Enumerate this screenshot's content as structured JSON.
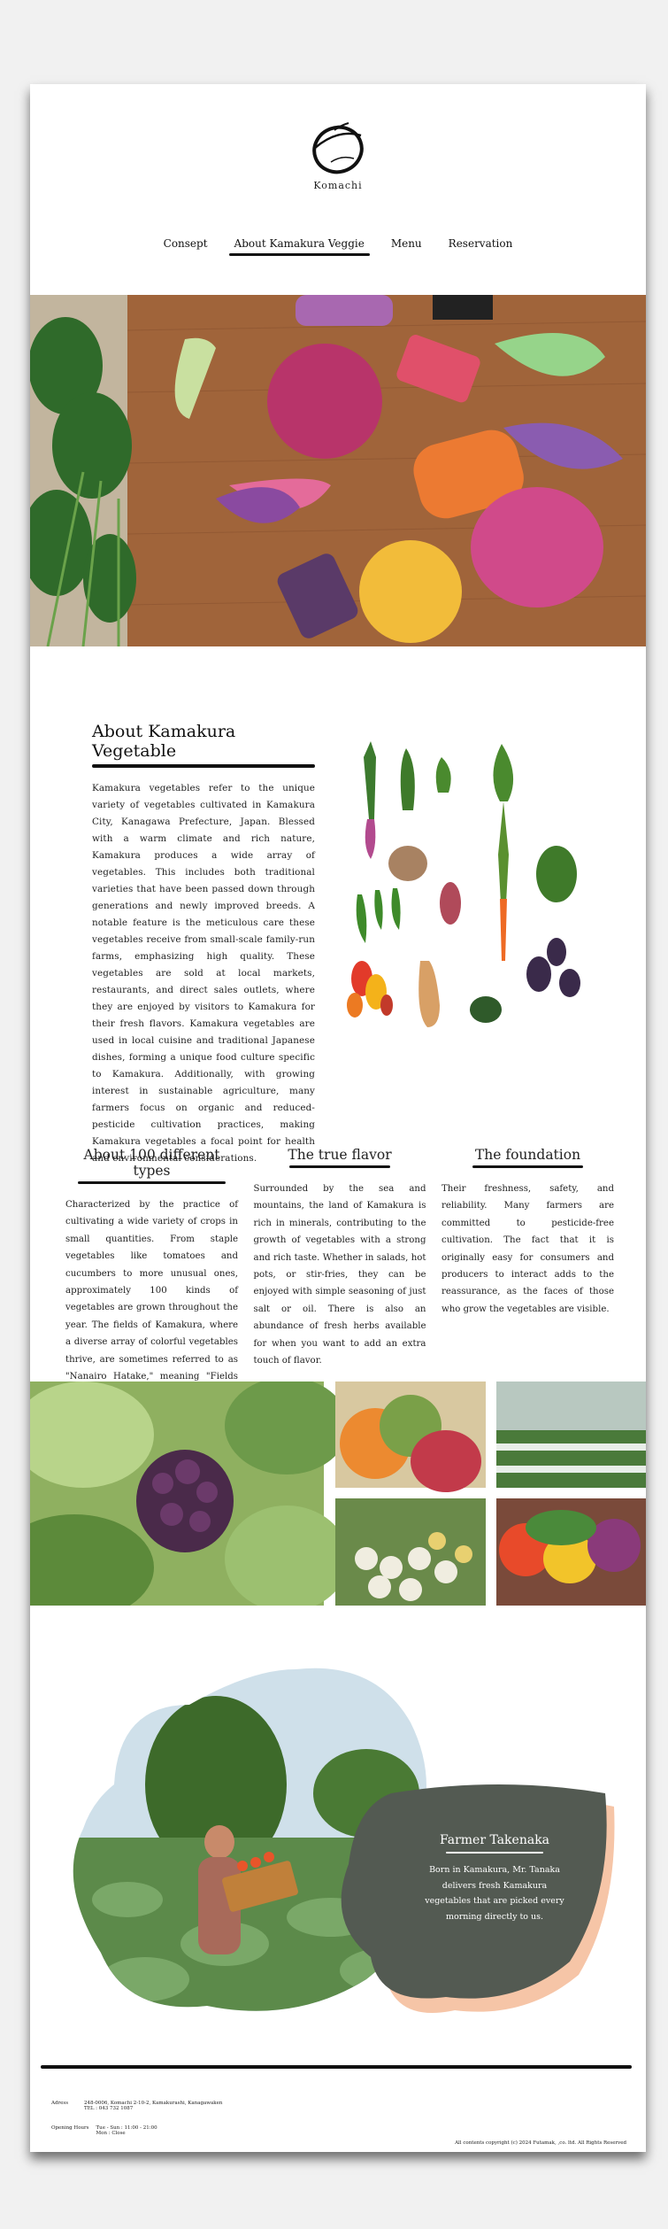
{
  "brand": {
    "name": "Komachi"
  },
  "nav": {
    "items": [
      {
        "label": "Consept",
        "active": false
      },
      {
        "label": "About Kamakura Veggie",
        "active": true
      },
      {
        "label": "Menu",
        "active": false
      },
      {
        "label": "Reservation",
        "active": false
      }
    ]
  },
  "about": {
    "title": "About Kamakura Vegetable",
    "body": "Kamakura vegetables refer to the unique variety of vegetables cultivated in Kamakura City, Kanagawa Prefecture, Japan. Blessed with a warm climate and rich nature, Kamakura produces a wide array of vegetables. This includes both traditional varieties that have been passed down through generations and newly improved breeds. A notable feature is the meticulous care these vegetables receive from small-scale family-run farms, emphasizing high quality. These vegetables are sold at local markets, restaurants, and direct sales outlets, where they are enjoyed by visitors to Kamakura for their fresh flavors. Kamakura vegetables are used in local cuisine and traditional Japanese dishes, forming a unique food culture specific to Kamakura. Additionally, with growing interest in sustainable agriculture, many farmers focus on organic and reduced-pesticide cultivation practices, making Kamakura vegetables a focal point for health and environmental considerations."
  },
  "features": [
    {
      "title": "About 100 different types",
      "body": "Characterized by the practice of cultivating a wide variety of crops in small quantities. From staple vegetables like tomatoes and cucumbers to more unusual ones, approximately 100 kinds of vegetables are grown throughout the year. The fields of Kamakura, where a diverse array of colorful vegetables thrive, are sometimes referred to as \"Nanairo Hatake,\" meaning \"Fields of Seven Colors."
    },
    {
      "title": "The true flavor",
      "body": "Surrounded by the sea and mountains, the land of Kamakura is rich in minerals, contributing to the growth of vegetables with a strong and rich taste. Whether in salads, hot pots, or stir-fries, they can be enjoyed with simple seasoning of just salt or oil. There is also an abundance of fresh herbs available for when you want to add an extra touch of flavor."
    },
    {
      "title": "The foundation",
      "body": "Their freshness, safety, and reliability. Many farmers are committed to pesticide-free cultivation. The fact that it is originally easy for consumers and producers to interact adds to the reassurance, as the faces of those who grow the vegetables are visible."
    }
  ],
  "farmer": {
    "title": "Farmer Takenaka",
    "body": "Born in Kamakura, Mr. Tanaka delivers fresh Kamakura vegetables that are picked every morning directly to us.",
    "colors": {
      "card": "#535a52",
      "shadow": "#f6c5a7"
    }
  },
  "footer": {
    "address_label": "Adress",
    "address": "248-0006, Komachi 2-10-2, Kamakurashi, Kanagawaken",
    "tel": "TEL : 043 732 1087",
    "hours_label": "Opening Hours",
    "hours_1": "Tue - Sun : 11:00 - 21:00",
    "hours_2": "Mon : Close",
    "copyright": "All contents copyright (c) 2024 Futamak, ,co. ltd. All Rights Reserved"
  },
  "icons": [
    "komachi-logo",
    "hero-vegetables-photo",
    "vegetables-illustration",
    "gallery-photos",
    "farmer-photo"
  ]
}
